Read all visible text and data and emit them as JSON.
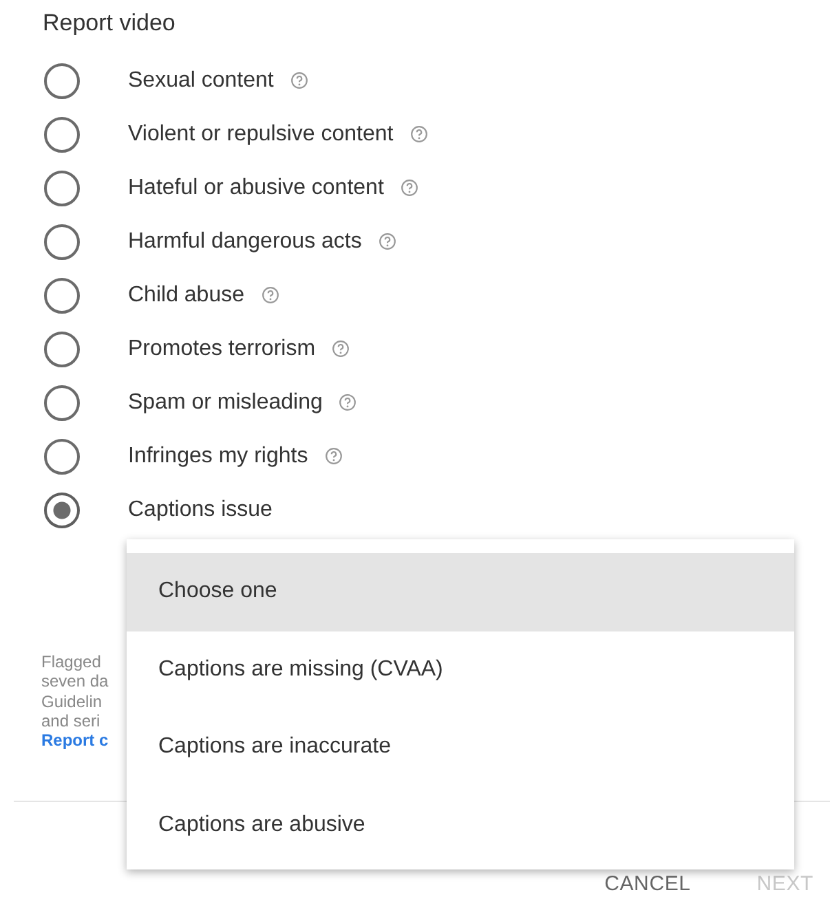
{
  "title": "Report video",
  "options": [
    {
      "label": "Sexual content",
      "help": true,
      "selected": false
    },
    {
      "label": "Violent or repulsive content",
      "help": true,
      "selected": false
    },
    {
      "label": "Hateful or abusive content",
      "help": true,
      "selected": false
    },
    {
      "label": "Harmful dangerous acts",
      "help": true,
      "selected": false
    },
    {
      "label": "Child abuse",
      "help": true,
      "selected": false
    },
    {
      "label": "Promotes terrorism",
      "help": true,
      "selected": false
    },
    {
      "label": "Spam or misleading",
      "help": true,
      "selected": false
    },
    {
      "label": "Infringes my rights",
      "help": true,
      "selected": false
    },
    {
      "label": "Captions issue",
      "help": false,
      "selected": true
    }
  ],
  "notice_lines": [
    "Flagged",
    "seven da",
    "Guidelin",
    "and seri"
  ],
  "notice_link": "Report c",
  "buttons": [
    {
      "label": "CANCEL",
      "disabled": false
    },
    {
      "label": "NEXT",
      "disabled": true
    }
  ],
  "menu": {
    "items": [
      {
        "label": "Choose one",
        "selected": true
      },
      {
        "label": "Captions are missing (CVAA)",
        "selected": false
      },
      {
        "label": "Captions are inaccurate",
        "selected": false
      },
      {
        "label": "Captions are abusive",
        "selected": false
      }
    ]
  }
}
